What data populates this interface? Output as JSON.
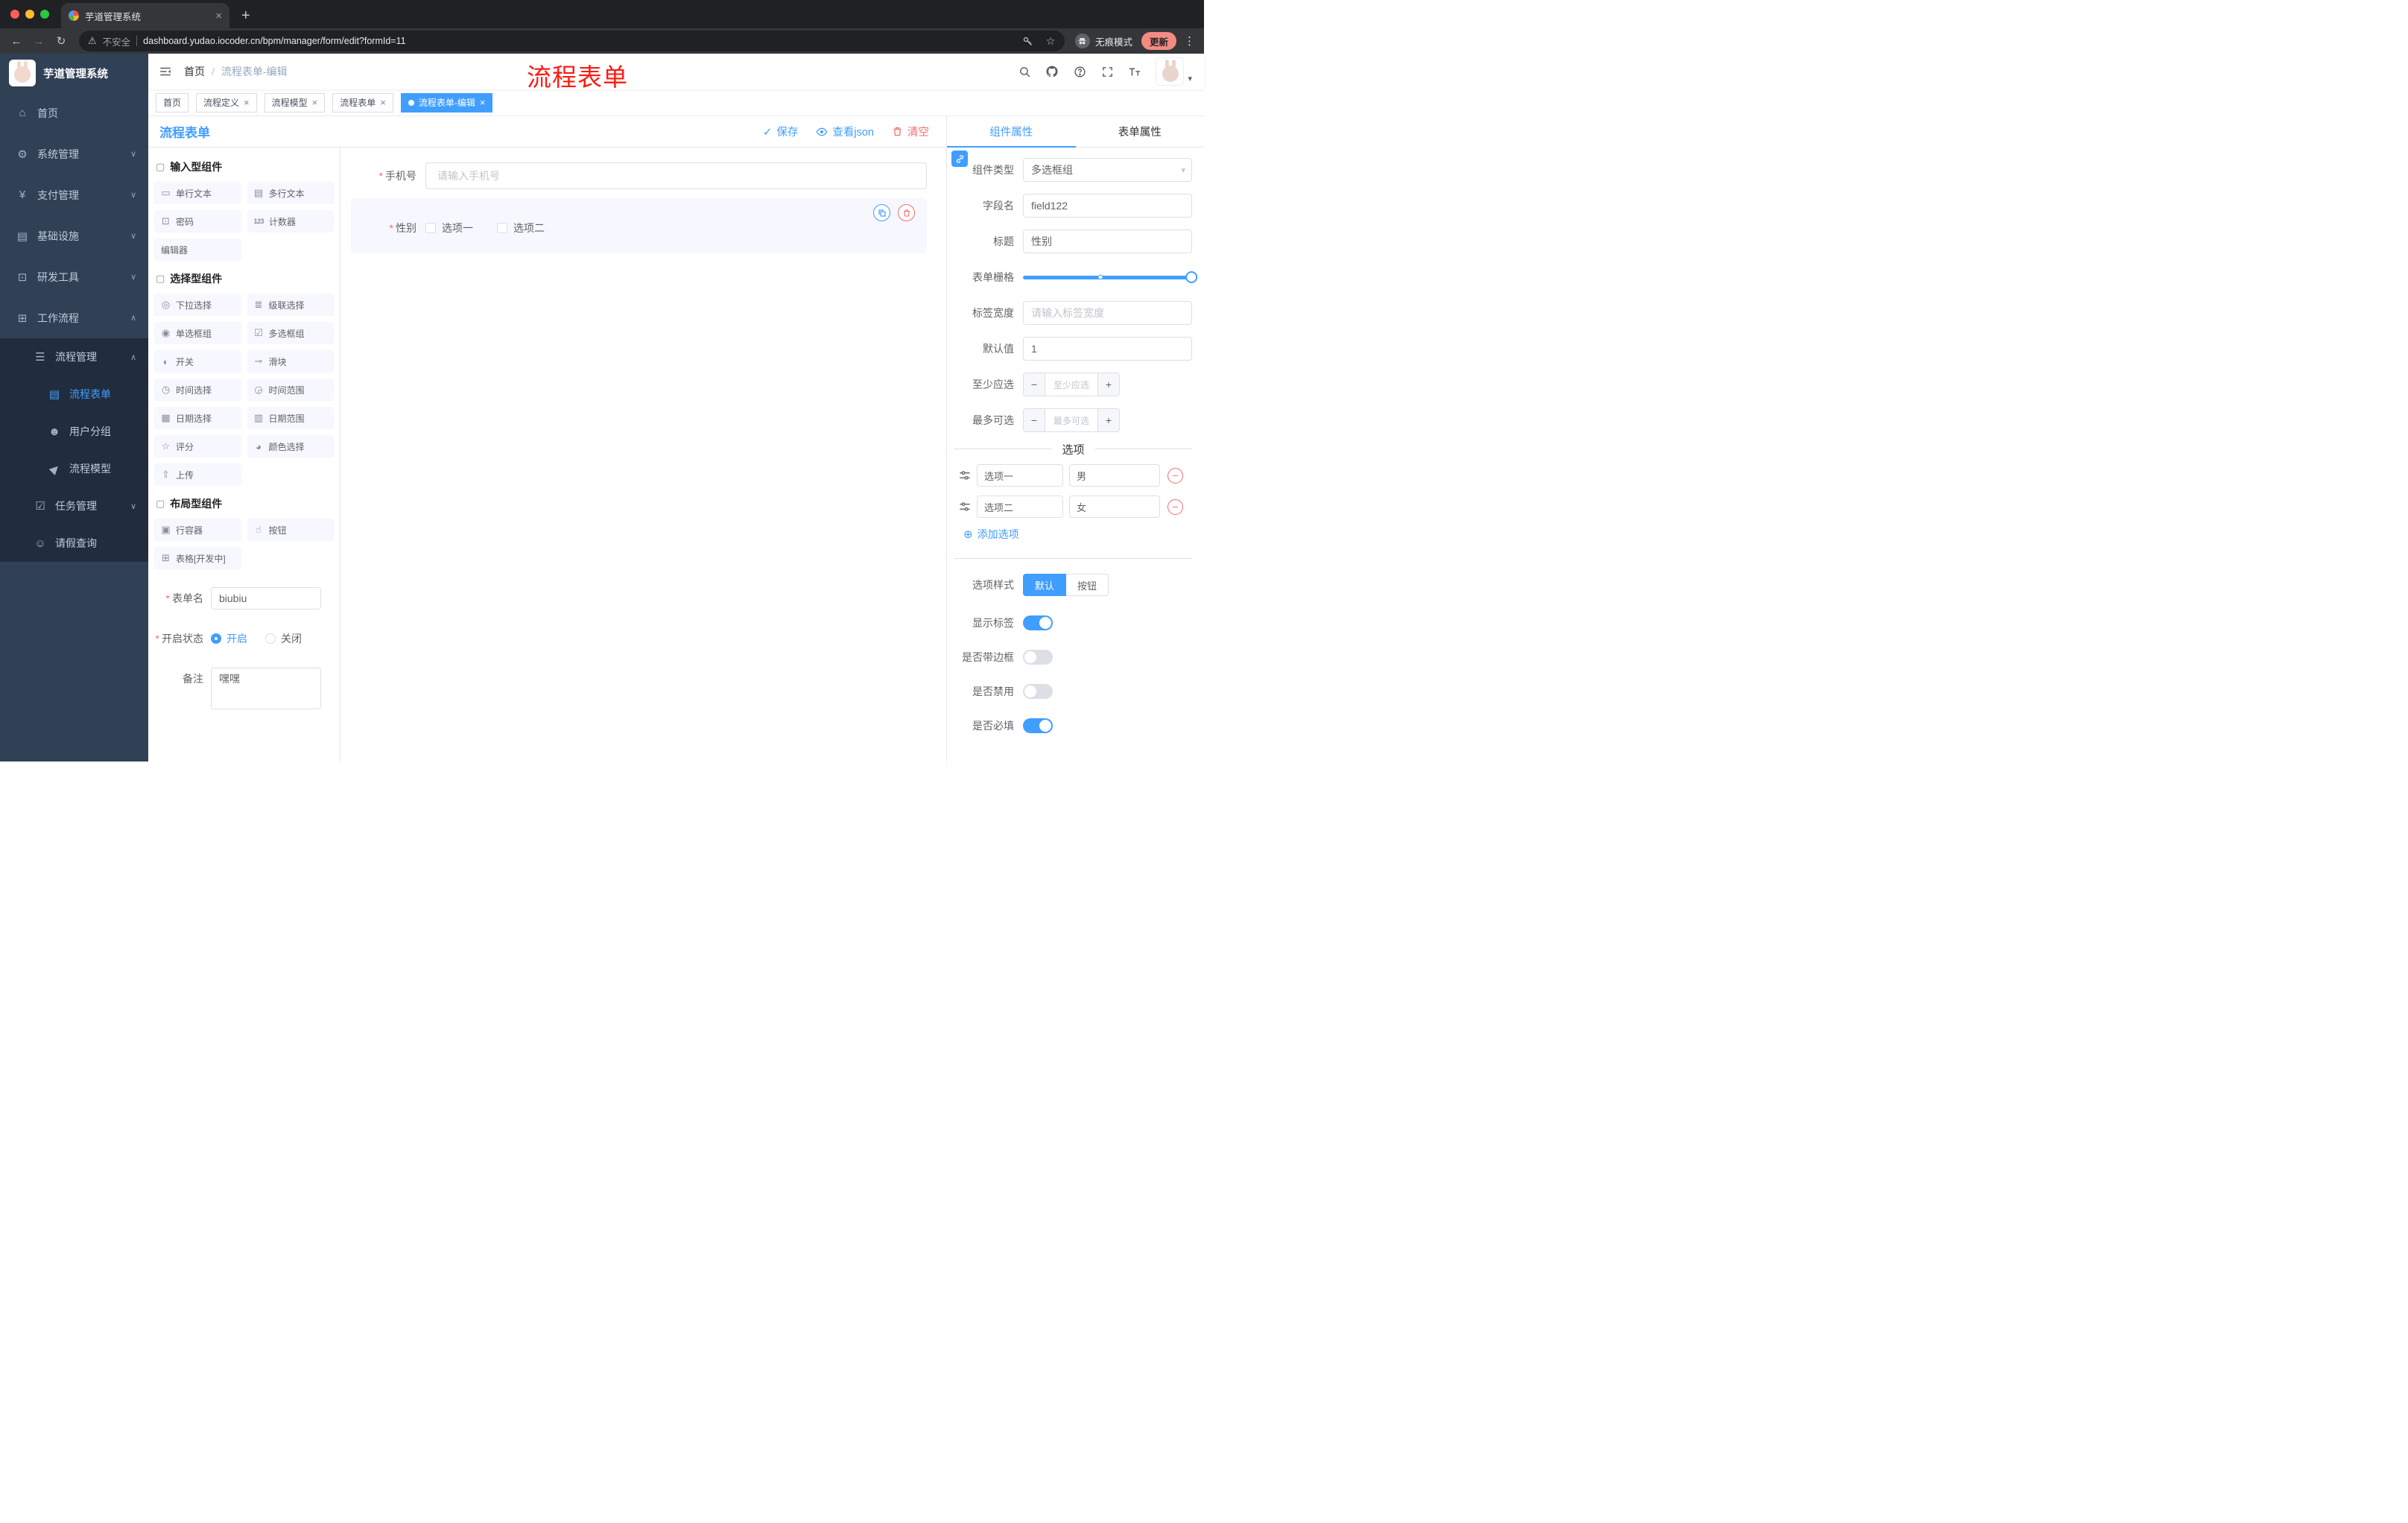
{
  "browser": {
    "tab_title": "芋道管理系统",
    "security_label": "不安全",
    "url": "dashboard.yudao.iocoder.cn/bpm/manager/form/edit?formId=11",
    "incognito_label": "无痕模式",
    "update_label": "更新"
  },
  "annotation": "流程表单",
  "sidebar": {
    "logo_title": "芋道管理系统",
    "items": [
      {
        "icon": "⌂",
        "label": "首页",
        "chevron": ""
      },
      {
        "icon": "⚙",
        "label": "系统管理",
        "chevron": "∨"
      },
      {
        "icon": "¥",
        "label": "支付管理",
        "chevron": "∨"
      },
      {
        "icon": "▤",
        "label": "基础设施",
        "chevron": "∨"
      },
      {
        "icon": "⊡",
        "label": "研发工具",
        "chevron": "∨"
      },
      {
        "icon": "⊞",
        "label": "工作流程",
        "chevron": "∧"
      }
    ],
    "sub": [
      {
        "icon": "☰",
        "label": "流程管理",
        "chevron": "∧"
      },
      {
        "icon": "▤",
        "label": "流程表单",
        "chevron": ""
      },
      {
        "icon": "☻",
        "label": "用户分组",
        "chevron": ""
      },
      {
        "icon": "▶",
        "label": "流程模型",
        "chevron": ""
      },
      {
        "icon": "☑",
        "label": "任务管理",
        "chevron": "∨"
      },
      {
        "icon": "☺",
        "label": "请假查询",
        "chevron": ""
      }
    ]
  },
  "header": {
    "breadcrumb_home": "首页",
    "breadcrumb_sep": "/",
    "breadcrumb_current": "流程表单-编辑"
  },
  "tags": [
    {
      "label": "首页"
    },
    {
      "label": "流程定义"
    },
    {
      "label": "流程模型"
    },
    {
      "label": "流程表单"
    },
    {
      "label": "流程表单-编辑"
    }
  ],
  "designer": {
    "title": "流程表单",
    "save_label": "保存",
    "json_label": "查看json",
    "clear_label": "清空"
  },
  "palette": {
    "groups": [
      {
        "title": "输入型组件",
        "items": [
          {
            "icon": "▭",
            "label": "单行文本"
          },
          {
            "icon": "▤",
            "label": "多行文本"
          },
          {
            "icon": "⊡",
            "label": "密码"
          },
          {
            "icon": "123",
            "label": "计数器"
          },
          {
            "icon": "",
            "label": "编辑器"
          }
        ]
      },
      {
        "title": "选择型组件",
        "items": [
          {
            "icon": "◎",
            "label": "下拉选择"
          },
          {
            "icon": "≣",
            "label": "级联选择"
          },
          {
            "icon": "◉",
            "label": "单选框组"
          },
          {
            "icon": "☑",
            "label": "多选框组"
          },
          {
            "icon": "◐",
            "label": "开关"
          },
          {
            "icon": "⊸",
            "label": "滑块"
          },
          {
            "icon": "◷",
            "label": "时间选择"
          },
          {
            "icon": "◶",
            "label": "时间范围"
          },
          {
            "icon": "▦",
            "label": "日期选择"
          },
          {
            "icon": "▥",
            "label": "日期范围"
          },
          {
            "icon": "☆",
            "label": "评分"
          },
          {
            "icon": "◕",
            "label": "颜色选择"
          },
          {
            "icon": "⇧",
            "label": "上传"
          }
        ]
      },
      {
        "title": "布局型组件",
        "items": [
          {
            "icon": "▣",
            "label": "行容器"
          },
          {
            "icon": "☝",
            "label": "按钮"
          },
          {
            "icon": "⊞",
            "label": "表格[开发中]"
          }
        ]
      }
    ]
  },
  "meta": {
    "name_label": "表单名",
    "name_value": "biubiu",
    "status_label": "开启状态",
    "status_on": "开启",
    "status_off": "关闭",
    "remark_label": "备注",
    "remark_value": "嘿嘿"
  },
  "canvas": {
    "phone_label": "手机号",
    "phone_placeholder": "请输入手机号",
    "gender_label": "性别",
    "gender_opt1": "选项一",
    "gender_opt2": "选项二"
  },
  "props": {
    "tab_component": "组件属性",
    "tab_form": "表单属性",
    "type_label": "组件类型",
    "type_value": "多选框组",
    "field_label": "字段名",
    "field_value": "field122",
    "title_label": "标题",
    "title_value": "性别",
    "grid_label": "表单栅格",
    "width_label": "标签宽度",
    "width_placeholder": "请输入标签宽度",
    "default_label": "默认值",
    "default_value": "1",
    "min_label": "至少应选",
    "min_placeholder": "至少应选",
    "max_label": "最多可选",
    "max_placeholder": "最多可选",
    "options_title": "选项",
    "option_rows": [
      {
        "name": "选项一",
        "value": "男"
      },
      {
        "name": "选项二",
        "value": "女"
      }
    ],
    "add_label": "添加选项",
    "style_label": "选项样式",
    "style_default": "默认",
    "style_button": "按钮",
    "toggles": [
      {
        "label": "显示标签",
        "on": true
      },
      {
        "label": "是否带边框",
        "on": false
      },
      {
        "label": "是否禁用",
        "on": false
      },
      {
        "label": "是否必填",
        "on": true
      }
    ]
  }
}
